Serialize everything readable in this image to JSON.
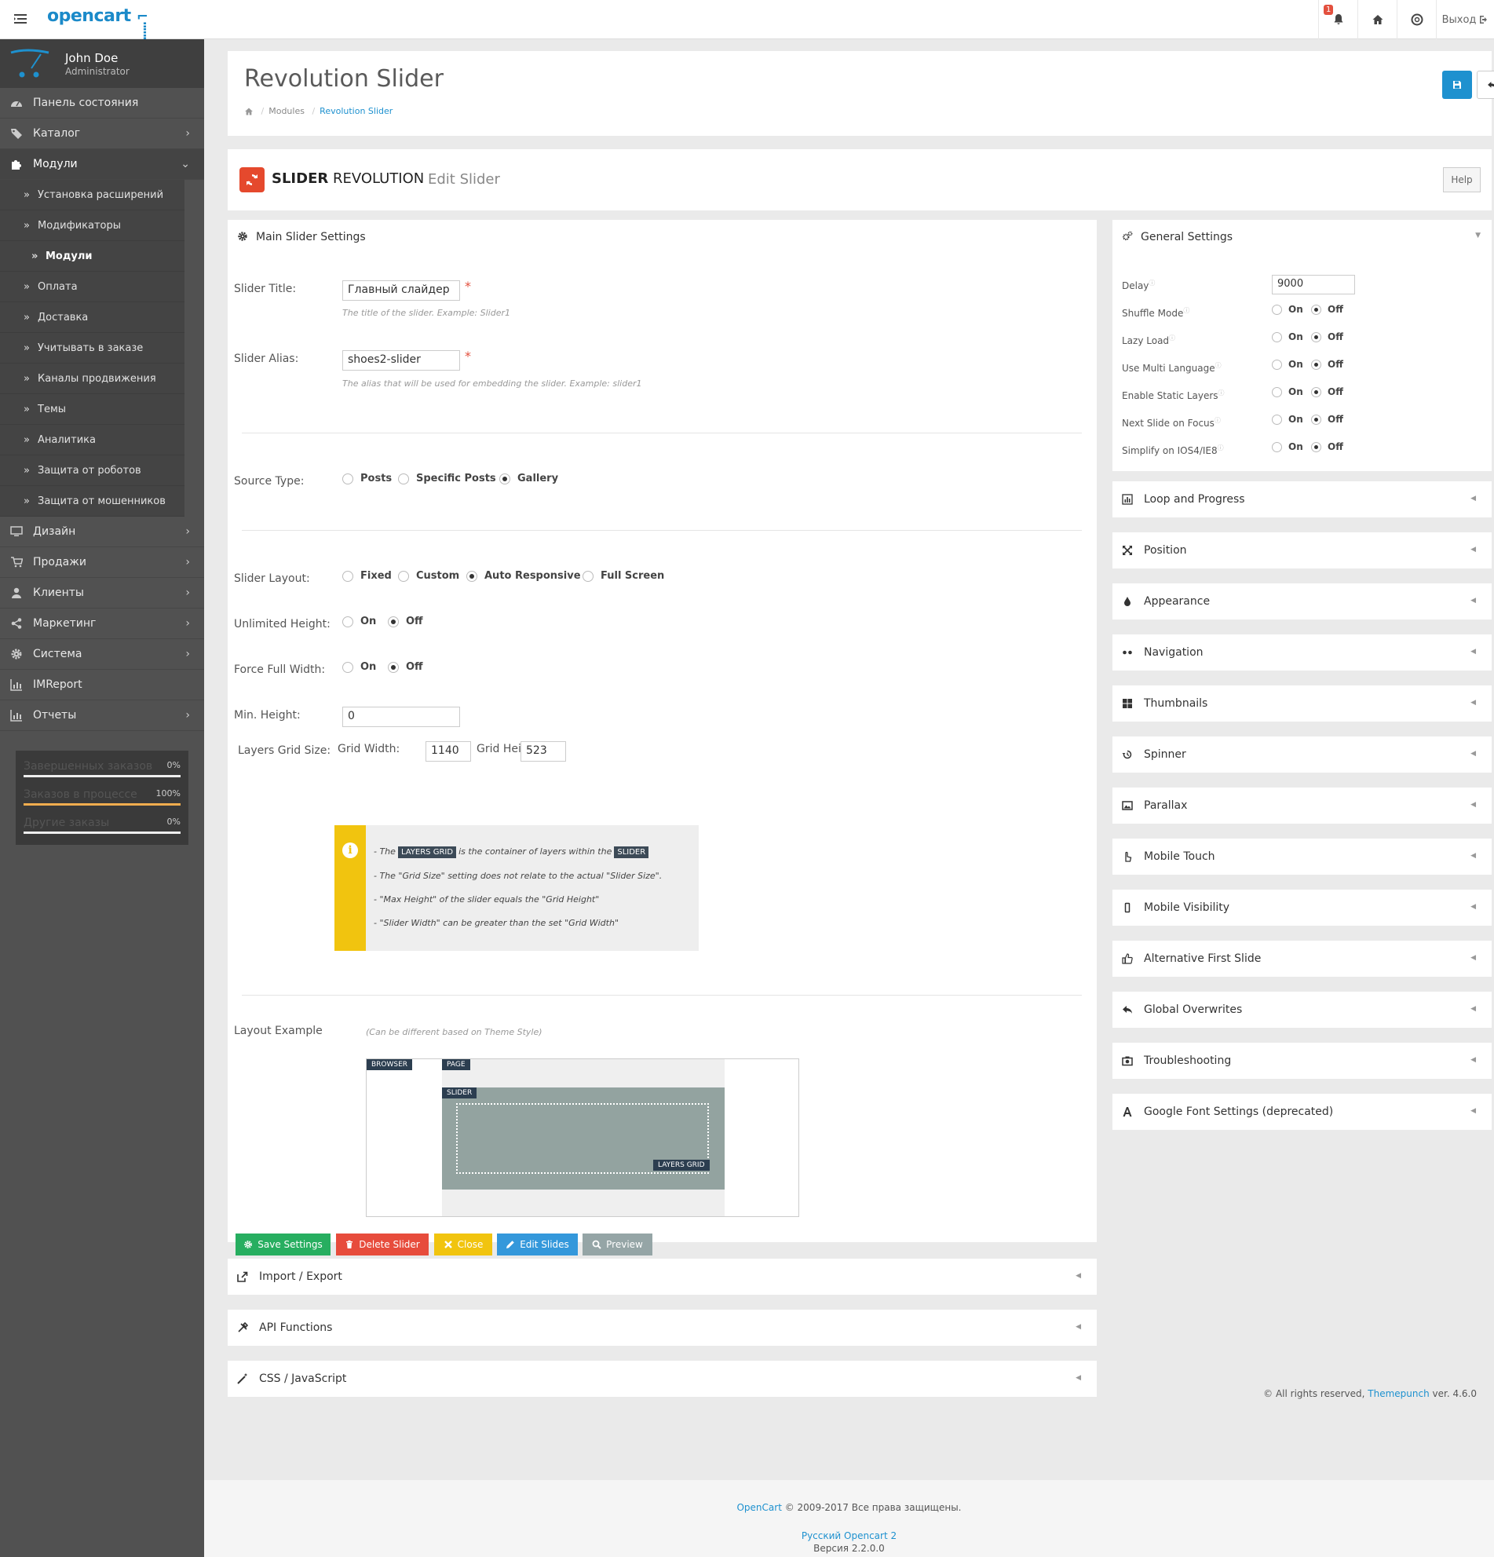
{
  "header": {
    "brand": "opencart",
    "notifications_count": "1",
    "logout_label": "Выход"
  },
  "sidebar": {
    "user_name": "John Doe",
    "user_role": "Administrator",
    "items": [
      {
        "label": "Панель состояния",
        "icon": "dashboard-icon"
      },
      {
        "label": "Каталог",
        "icon": "tags-icon"
      },
      {
        "label": "Модули",
        "icon": "puzzle-icon"
      },
      {
        "label": "Дизайн",
        "icon": "monitor-icon"
      },
      {
        "label": "Продажи",
        "icon": "cart-icon"
      },
      {
        "label": "Клиенты",
        "icon": "user-icon"
      },
      {
        "label": "Маркетинг",
        "icon": "share-icon"
      },
      {
        "label": "Система",
        "icon": "gear-icon"
      },
      {
        "label": "IMReport",
        "icon": "bar-chart-icon"
      },
      {
        "label": "Отчеты",
        "icon": "bar-chart-icon"
      }
    ],
    "sub_items": [
      "Установка расширений",
      "Модификаторы",
      "Модули",
      "Оплата",
      "Доставка",
      "Учитывать в заказе",
      "Каналы продвижения",
      "Темы",
      "Аналитика",
      "Защита от роботов",
      "Защита от мошенников"
    ],
    "stats": [
      {
        "label": "Завершенных заказов",
        "pct": "0%",
        "value": 0
      },
      {
        "label": "Заказов в процессе",
        "pct": "100%",
        "value": 100
      },
      {
        "label": "Другие заказы",
        "pct": "0%",
        "value": 0
      }
    ]
  },
  "page": {
    "title": "Revolution Slider",
    "breadcrumb": [
      "Modules",
      "Revolution Slider"
    ]
  },
  "brand": {
    "bold": "SLIDER",
    "rest": " REVOLUTION",
    "subtitle": "Edit Slider",
    "help": "Help"
  },
  "main_settings": {
    "heading": "Main Slider Settings",
    "slider_title_label": "Slider Title:",
    "slider_title_value": "Главный слайдер",
    "slider_title_hint": "The title of the slider. Example: Slider1",
    "slider_alias_label": "Slider Alias:",
    "slider_alias_value": "shoes2-slider",
    "slider_alias_hint": "The alias that will be used for embedding the slider. Example: slider1",
    "source_type_label": "Source Type:",
    "source_types": [
      "Posts",
      "Specific Posts",
      "Gallery"
    ],
    "slider_layout_label": "Slider Layout:",
    "layouts": [
      "Fixed",
      "Custom",
      "Auto Responsive",
      "Full Screen"
    ],
    "unlimited_height_label": "Unlimited Height:",
    "force_full_width_label": "Force Full Width:",
    "on": "On",
    "off": "Off",
    "min_height_label": "Min. Height:",
    "min_height_value": "0",
    "grid_size_label": "Layers Grid Size:",
    "grid_width_label": "Grid Width:",
    "grid_width_value": "1140",
    "grid_height_label": "Grid Height:",
    "grid_height_value": "523",
    "info": {
      "line1_a": "- The",
      "line1_tag1": "LAYERS GRID",
      "line1_b": "is the container of layers within the",
      "line1_tag2": "SLIDER",
      "line2": "- The \"Grid Size\" setting does not relate to the actual \"Slider Size\".",
      "line3": "- \"Max Height\" of the slider equals the \"Grid Height\"",
      "line4": "- \"Slider Width\" can be greater than the set \"Grid Width\""
    },
    "layout_example_label": "Layout Example",
    "layout_example_hint": "(Can be different based on Theme Style)",
    "example_tags": [
      "BROWSER",
      "PAGE",
      "SLIDER",
      "LAYERS GRID"
    ],
    "buttons": [
      "Save Settings",
      "Delete Slider",
      "Close",
      "Edit Slides",
      "Preview"
    ]
  },
  "bottom_panels": [
    "Import / Export",
    "API Functions",
    "CSS / JavaScript"
  ],
  "general_settings": {
    "heading": "General Settings",
    "delay_label": "Delay",
    "delay_value": "9000",
    "rows": [
      "Shuffle Mode",
      "Lazy Load",
      "Use Multi Language",
      "Enable Static Layers",
      "Next Slide on Focus",
      "Simplify on IOS4/IE8"
    ]
  },
  "right_panels": [
    "Loop and Progress",
    "Position",
    "Appearance",
    "Navigation",
    "Thumbnails",
    "Spinner",
    "Parallax",
    "Mobile Touch",
    "Mobile Visibility",
    "Alternative First Slide",
    "Global Overwrites",
    "Troubleshooting",
    "Google Font Settings (deprecated)"
  ],
  "copyright": {
    "prefix": "© All rights reserved, ",
    "link": "Themepunch",
    "suffix": " ver. 4.6.0"
  },
  "footer": {
    "link1": "OpenCart",
    "text1": " © 2009-2017 Все права защищены.",
    "link2": "Русский Opencart 2",
    "version": "Версия 2.2.0.0"
  },
  "colors": {
    "primary": "#1e91cf",
    "save": "#27ae60",
    "delete": "#e74c3c",
    "close": "#f1c40f",
    "edit": "#3498db",
    "preview": "#95a5a6",
    "sidebar": "#515151"
  }
}
